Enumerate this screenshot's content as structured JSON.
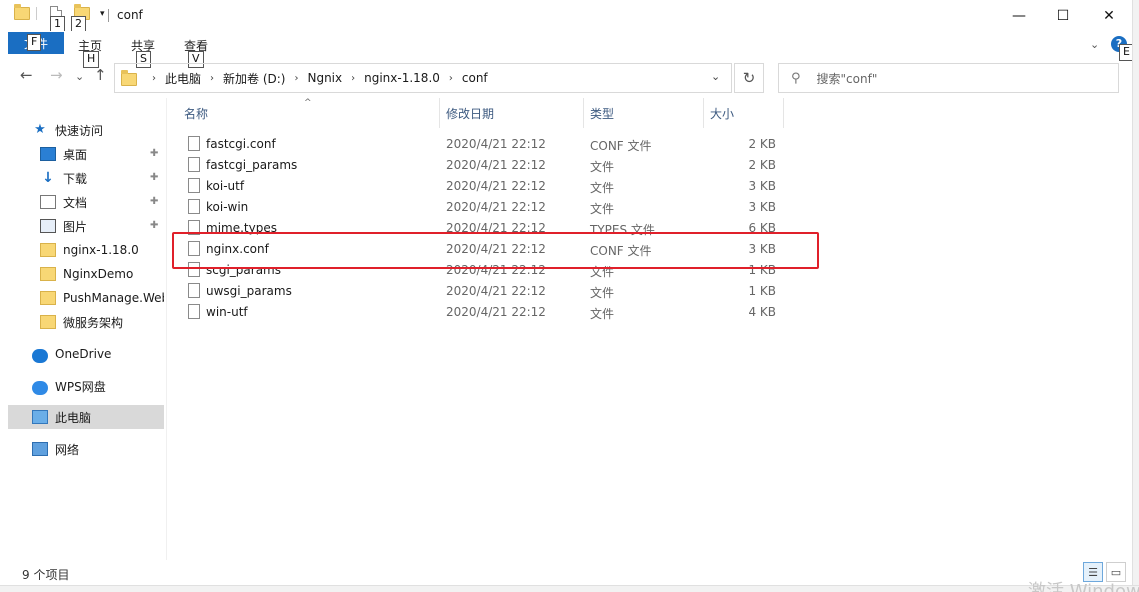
{
  "window": {
    "title": "conf",
    "controls": {
      "minimize": "—",
      "maximize": "☐",
      "close": "✕"
    }
  },
  "quick_access_toolbar": {
    "keytips": [
      "1",
      "2"
    ]
  },
  "ribbon": {
    "file_tab": "文件",
    "file_keytip": "F",
    "tabs": [
      {
        "label": "主页",
        "keytip": "H"
      },
      {
        "label": "共享",
        "keytip": "S"
      },
      {
        "label": "查看",
        "keytip": "V"
      }
    ],
    "help_keytip": "E",
    "help_label": "?"
  },
  "navigation": {
    "back": "←",
    "forward": "→",
    "recent": "⌄",
    "up": "↑",
    "breadcrumb": [
      "此电脑",
      "新加卷 (D:)",
      "Ngnix",
      "nginx-1.18.0",
      "conf"
    ],
    "refresh": "↻",
    "search_placeholder": "搜索\"conf\""
  },
  "sidebar": {
    "items": [
      {
        "label": "快速访问",
        "icon": "star-icon"
      },
      {
        "label": "桌面",
        "icon": "desktop-icon",
        "pinned": true
      },
      {
        "label": "下载",
        "icon": "download-icon",
        "pinned": true
      },
      {
        "label": "文档",
        "icon": "document-icon",
        "pinned": true
      },
      {
        "label": "图片",
        "icon": "picture-icon",
        "pinned": true
      },
      {
        "label": "nginx-1.18.0",
        "icon": "folder-icon"
      },
      {
        "label": "NginxDemo",
        "icon": "folder-icon"
      },
      {
        "label": "PushManage.Web",
        "icon": "folder-icon"
      },
      {
        "label": "微服务架构",
        "icon": "folder-icon"
      },
      {
        "label": "OneDrive",
        "icon": "cloud-icon"
      },
      {
        "label": "WPS网盘",
        "icon": "cloud-icon"
      },
      {
        "label": "此电脑",
        "icon": "computer-icon",
        "selected": true
      },
      {
        "label": "网络",
        "icon": "network-icon"
      }
    ],
    "pin_glyph": "📌"
  },
  "columns": {
    "name": "名称",
    "date": "修改日期",
    "type": "类型",
    "size": "大小",
    "sort_caret": "^"
  },
  "files": [
    {
      "name": "fastcgi.conf",
      "date": "2020/4/21 22:12",
      "type": "CONF 文件",
      "size": "2 KB"
    },
    {
      "name": "fastcgi_params",
      "date": "2020/4/21 22:12",
      "type": "文件",
      "size": "2 KB"
    },
    {
      "name": "koi-utf",
      "date": "2020/4/21 22:12",
      "type": "文件",
      "size": "3 KB"
    },
    {
      "name": "koi-win",
      "date": "2020/4/21 22:12",
      "type": "文件",
      "size": "3 KB"
    },
    {
      "name": "mime.types",
      "date": "2020/4/21 22:12",
      "type": "TYPES 文件",
      "size": "6 KB"
    },
    {
      "name": "nginx.conf",
      "date": "2020/4/21 22:12",
      "type": "CONF 文件",
      "size": "3 KB"
    },
    {
      "name": "scgi_params",
      "date": "2020/4/21 22:12",
      "type": "文件",
      "size": "1 KB"
    },
    {
      "name": "uwsgi_params",
      "date": "2020/4/21 22:12",
      "type": "文件",
      "size": "1 KB"
    },
    {
      "name": "win-utf",
      "date": "2020/4/21 22:12",
      "type": "文件",
      "size": "4 KB"
    }
  ],
  "status": {
    "item_count": "9 个项目",
    "watermark": "激活 Windows"
  }
}
